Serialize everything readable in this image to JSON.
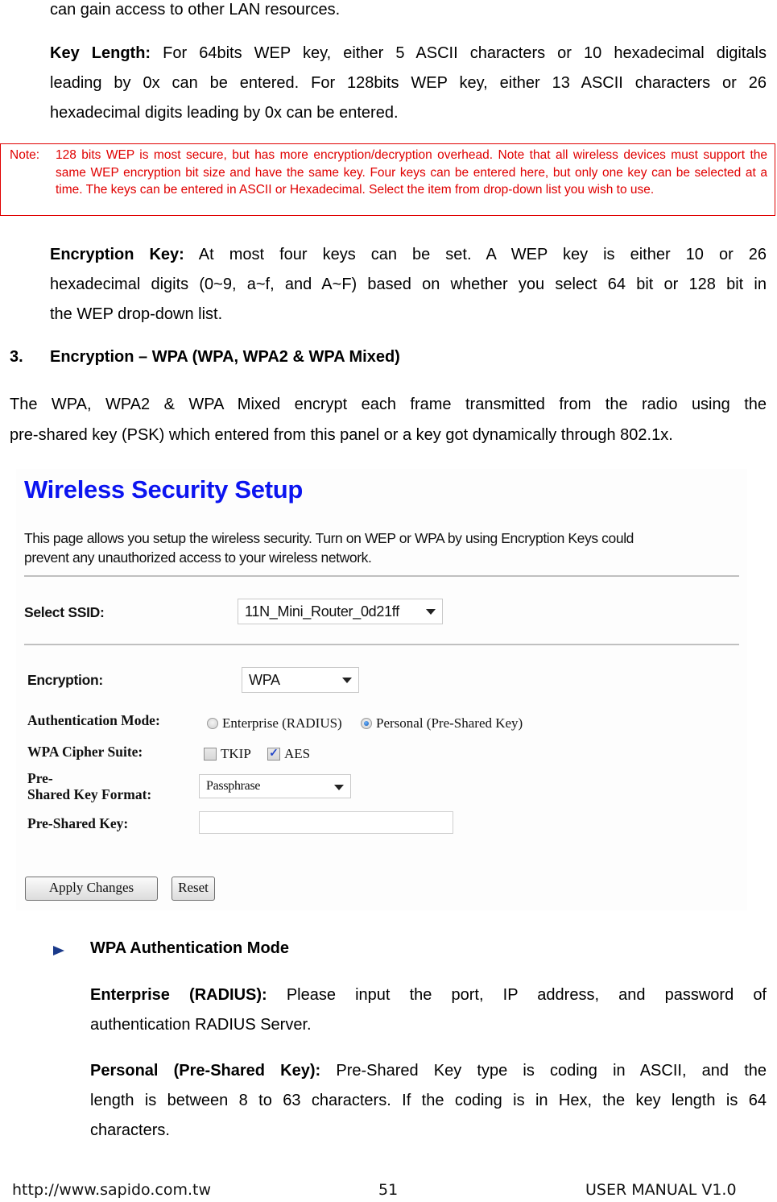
{
  "doc": {
    "intro_tail": "can gain access to other LAN resources.",
    "key_length": {
      "label": "Key Length:",
      "text_line1": " For 64bits WEP key, either 5 ASCII characters or 10 hexadecimal digitals",
      "text_line2": "leading by 0x can be entered. For 128bits WEP key, either 13 ASCII characters or 26",
      "text_line3": "hexadecimal digits leading by 0x can be entered."
    },
    "note": {
      "label": "Note:",
      "text": "128 bits WEP is most secure, but has more encryption/decryption overhead. Note that all wireless devices must support the same WEP encryption bit size and have the same key. Four keys can be entered here, but only one key can be selected at a time. The keys can be entered in ASCII or Hexadecimal. Select the item from drop-down list you wish to use."
    },
    "encryption_key": {
      "label": "Encryption Key:",
      "text_line1": " At most four keys can be set. A WEP key is either 10 or 26",
      "text_line2": "hexadecimal digits (0~9, a~f, and A~F) based on whether you select 64 bit or 128 bit in",
      "text_line3": "the WEP drop-down list."
    },
    "section3": {
      "number": "3.",
      "title": "Encryption – WPA (WPA, WPA2 & WPA Mixed)"
    },
    "wpa_intro": {
      "line1": "The WPA, WPA2 & WPA Mixed encrypt each frame transmitted from the radio using the",
      "line2": "pre-shared key (PSK) which entered from this panel or a key got dynamically through 802.1x."
    },
    "bullet": {
      "icon": "triangle-bullet-icon",
      "title": "WPA Authentication Mode"
    },
    "enterprise": {
      "label": "Enterprise (RADIUS):",
      "text_line1": " Please input the port, IP address, and password of",
      "text_line2": "authentication RADIUS Server."
    },
    "personal": {
      "label": "Personal (Pre-Shared Key):",
      "text_line1": " Pre-Shared Key type is coding in ASCII, and the",
      "text_line2": "length is between 8 to 63 characters. If the coding is in Hex, the key length is 64",
      "text_line3": "characters."
    }
  },
  "screenshot": {
    "title": "Wireless Security Setup",
    "title_color": "#0b14f0",
    "description_line1": "This page allows you setup the wireless security. Turn on WEP or WPA by using Encryption Keys could",
    "description_line2": "prevent any unauthorized access to your wireless network.",
    "ssid": {
      "label": "Select SSID:",
      "value": "11N_Mini_Router_0d21ff"
    },
    "encryption": {
      "label": "Encryption:",
      "value": "WPA"
    },
    "auth_mode": {
      "label": "Authentication Mode:",
      "options": [
        {
          "label": "Enterprise (RADIUS)",
          "selected": false
        },
        {
          "label": "Personal (Pre-Shared Key)",
          "selected": true
        }
      ]
    },
    "cipher_suite": {
      "label": "WPA Cipher Suite:",
      "options": [
        {
          "label": "TKIP",
          "checked": false
        },
        {
          "label": "AES",
          "checked": true
        }
      ]
    },
    "psk_format": {
      "label_line1": "Pre-",
      "label_line2": "Shared Key Format:",
      "value": "Passphrase"
    },
    "psk": {
      "label": "Pre-Shared Key:",
      "value": ""
    },
    "buttons": {
      "apply": "Apply Changes",
      "reset": "Reset"
    }
  },
  "footer": {
    "url": "http://www.sapido.com.tw",
    "page_number": "51",
    "manual": "USER MANUAL V1.0"
  }
}
